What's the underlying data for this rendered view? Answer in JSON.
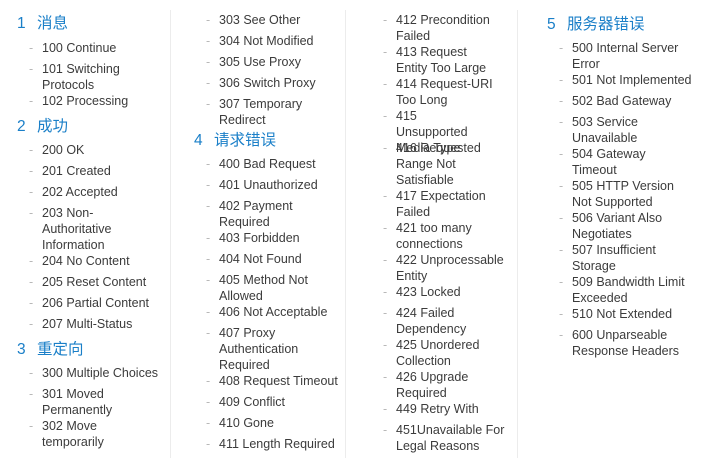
{
  "sections": [
    {
      "num": "1",
      "title": "消息",
      "items": [
        "100 Continue",
        "101 Switching Protocols",
        "102 Processing"
      ]
    },
    {
      "num": "2",
      "title": "成功",
      "items": [
        "200 OK",
        "201 Created",
        "202 Accepted",
        "203 Non-Authoritative Information",
        "204 No Content",
        "205 Reset Content",
        "206 Partial Content",
        "207 Multi-Status"
      ]
    },
    {
      "num": "3",
      "title": "重定向",
      "items": [
        "300 Multiple Choices",
        "301 Moved Permanently",
        "302 Move temporarily",
        "303 See Other",
        "304 Not Modified",
        "305 Use Proxy",
        "306 Switch Proxy",
        "307 Temporary Redirect"
      ]
    },
    {
      "num": "4",
      "title": "请求错误",
      "items": [
        "400 Bad Request",
        "401 Unauthorized",
        "402 Payment Required",
        "403 Forbidden",
        "404 Not Found",
        "405 Method Not Allowed",
        "406 Not Acceptable",
        "407 Proxy Authentication Required",
        "408 Request Timeout",
        "409 Conflict",
        "410 Gone",
        "411 Length Required",
        "412 Precondition Failed",
        "413 Request Entity Too Large",
        "414 Request-URI Too Long",
        "415 Unsupported Media Type",
        "416 Requested Range Not Satisfiable",
        "417 Expectation Failed",
        "421 too many connections",
        "422 Unprocessable Entity",
        "423 Locked",
        "424 Failed Dependency",
        "425 Unordered Collection",
        "426 Upgrade Required",
        "449 Retry With",
        "451Unavailable For Legal Reasons"
      ]
    },
    {
      "num": "5",
      "title": "服务器错误",
      "items": [
        "500 Internal Server Error",
        "501 Not Implemented",
        "502 Bad Gateway",
        "503 Service Unavailable",
        "504 Gateway Timeout",
        "505 HTTP Version Not Supported",
        "506 Variant Also Negotiates",
        "507 Insufficient Storage",
        "509 Bandwidth Limit Exceeded",
        "510 Not Extended",
        "600 Unparseable Response Headers"
      ]
    }
  ]
}
